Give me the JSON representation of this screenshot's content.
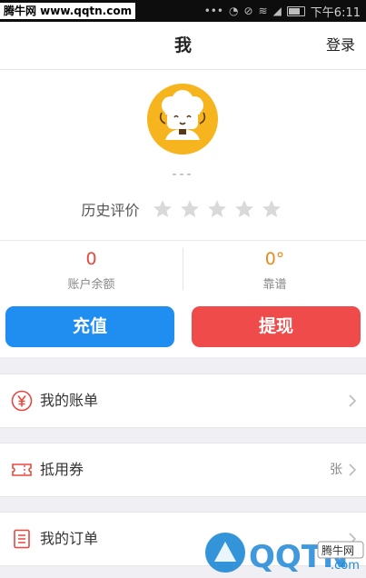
{
  "statusbar": {
    "watermark": "腾牛网 www.qqtn.com",
    "time": "下午6:11",
    "icons": [
      "more-icon",
      "alarm-icon",
      "no-sim-icon",
      "wifi-icon",
      "signal-icon",
      "battery-icon"
    ]
  },
  "navbar": {
    "title": "我",
    "login_label": "登录"
  },
  "profile": {
    "avatar_icon": "chef-avatar-icon",
    "nickname": "---",
    "rating_label": "历史评价",
    "rating_value": 0,
    "rating_max": 5
  },
  "stats": {
    "balance_value": "0",
    "balance_label": "账户余额",
    "reliability_value": "0°",
    "reliability_label": "靠谱"
  },
  "actions": {
    "recharge_label": "充值",
    "withdraw_label": "提现"
  },
  "menu": {
    "items": [
      {
        "label": "我的账单",
        "icon": "yen-icon",
        "right_text": ""
      },
      {
        "label": "抵用券",
        "icon": "ticket-icon",
        "right_text": "张"
      },
      {
        "label": "我的订单",
        "icon": "list-icon",
        "right_text": ""
      }
    ]
  },
  "watermark_bottom": {
    "brand": "QQTN",
    "domain": ".com",
    "badge": "腾牛网"
  },
  "colors": {
    "primary_blue": "#1f8ef0",
    "primary_red": "#f04b4b",
    "balance_red": "#e8483e",
    "reliability_orange": "#e98b1c",
    "avatar_yellow": "#f6b51e"
  }
}
